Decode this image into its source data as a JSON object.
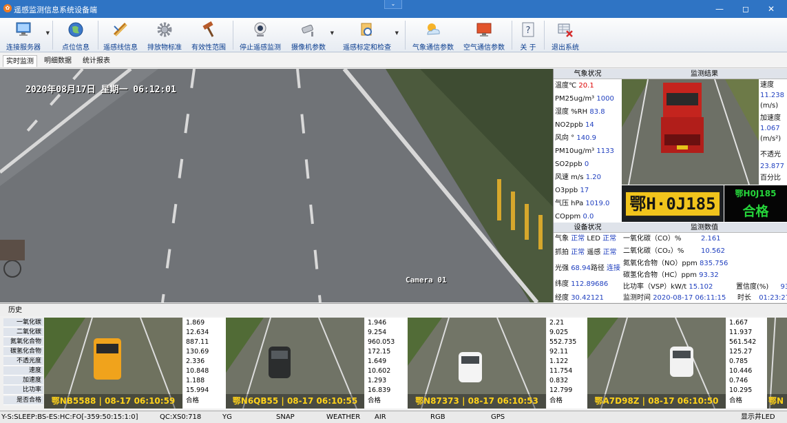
{
  "titlebar": {
    "title": "遥感监测信息系统设备端",
    "dropdown_glyph": "⌄",
    "minimize_glyph": "—",
    "maximize_glyph": "◻",
    "close_glyph": "✕"
  },
  "toolbar": {
    "buttons": [
      {
        "label": "连接服务器"
      },
      {
        "label": "点位信息"
      },
      {
        "label": "遥感线信息"
      },
      {
        "label": "排放物标准"
      },
      {
        "label": "有效性范围"
      },
      {
        "label": "停止遥感监测"
      },
      {
        "label": "摄像机参数"
      },
      {
        "label": "遥感标定和检查"
      },
      {
        "label": "气象通信参数"
      },
      {
        "label": "空气通信参数"
      },
      {
        "label": "关 于"
      },
      {
        "label": "退出系统"
      }
    ]
  },
  "tabs": [
    "实时监测",
    "明细数据",
    "统计报表"
  ],
  "video": {
    "timestamp": "2020年08月17日 星期一 06:12:01",
    "camera": "Camera 01"
  },
  "weather": {
    "header": "气象状况",
    "rows": [
      {
        "label": "温度℃",
        "value": "20.1"
      },
      {
        "label": "PM25ug/m³",
        "value": "1000"
      },
      {
        "label": "湿度 %RH",
        "value": "83.8"
      },
      {
        "label": "NO2ppb",
        "value": "14"
      },
      {
        "label": "风向 °",
        "value": "140.9"
      },
      {
        "label": "PM10ug/m³",
        "value": "1133"
      },
      {
        "label": "SO2ppb",
        "value": "0"
      },
      {
        "label": "风速 m/s",
        "value": "1.20"
      },
      {
        "label": "O3ppb",
        "value": "17"
      },
      {
        "label": "气压 hPa",
        "value": "1019.0"
      },
      {
        "label": "COppm",
        "value": "0.0"
      }
    ]
  },
  "result": {
    "header": "监测结果",
    "speed_label": "速度",
    "speed_value": "11.238",
    "speed_unit": "(m/s)",
    "accel_label": "加速度",
    "accel_value": "1.067",
    "accel_unit": "(m/s²)",
    "opacity_label": "不透光",
    "opacity_value": "23.877",
    "opacity_unit": "百分比",
    "plate_image_text": "鄂H·0J185",
    "plate_text": "鄂H0J185",
    "verdict": "合格"
  },
  "device": {
    "header": "设备状况",
    "rows": [
      [
        {
          "label": "气象",
          "value": "正常"
        },
        {
          "label": "LED",
          "value": "正常"
        }
      ],
      [
        {
          "label": "抓拍",
          "value": "正常"
        },
        {
          "label": "遥感",
          "value": "正常"
        }
      ],
      [
        {
          "label": "光强",
          "value": "68.94"
        },
        {
          "label": "路径",
          "value": "连接"
        }
      ],
      [
        {
          "label": "纬度",
          "value": "112.89686"
        }
      ],
      [
        {
          "label": "经度",
          "value": "30.42121"
        }
      ]
    ]
  },
  "values": {
    "header": "监测数值",
    "co_label": "一氧化碳（CO）%",
    "co_value": "2.161",
    "co2_label": "二氧化碳（CO₂）%",
    "co2_value": "10.562",
    "no_label": "氮氧化合物（NO）ppm",
    "no_value": "835.756",
    "hc_label": "碳氢化合物（HC）ppm",
    "hc_value": "93.32",
    "vsp_label": "比功率（VSP）kW/t",
    "vsp_value": "15.102",
    "conf_label": "置信度(%)",
    "conf_value": "93",
    "time_label": "监测时间",
    "time_value": "2020-08-17 06:11:15",
    "dur_label": "时长",
    "dur_value": "01:23:27"
  },
  "history": {
    "header": "历史",
    "labels": [
      "一氧化碳",
      "二氧化碳",
      "氮氧化合物",
      "碳氢化合物",
      "不透光度",
      "速度",
      "加速度",
      "比功率",
      "是否合格"
    ],
    "records": [
      {
        "caption": "鄂NB5588 | 08-17 06:10:59",
        "values": [
          "1.869",
          "12.634",
          "887.11",
          "130.69",
          "2.336",
          "10.848",
          "1.188",
          "15.994",
          "合格"
        ]
      },
      {
        "caption": "鄂N6QB55 | 08-17 06:10:55",
        "values": [
          "1.946",
          "9.254",
          "960.053",
          "172.15",
          "1.649",
          "10.602",
          "1.293",
          "16.839",
          "合格"
        ]
      },
      {
        "caption": "鄂N87373 | 08-17 06:10:53",
        "values": [
          "2.21",
          "9.025",
          "552.735",
          "92.11",
          "1.122",
          "11.754",
          "0.832",
          "12.799",
          "合格"
        ]
      },
      {
        "caption": "鄂A7D98Z | 08-17 06:10:50",
        "values": [
          "1.667",
          "11.937",
          "561.542",
          "125.27",
          "0.785",
          "10.446",
          "0.746",
          "10.295",
          "合格"
        ]
      },
      {
        "caption": "鄂N"
      }
    ]
  },
  "status": [
    "Y-S:SLEEP:BS-ES:HC:FO[-359:50:15:1:0]",
    "QC:XS0:718",
    "YG",
    "SNAP",
    "WEATHER",
    "AIR",
    "RGB",
    "GPS",
    "显示井LED"
  ]
}
